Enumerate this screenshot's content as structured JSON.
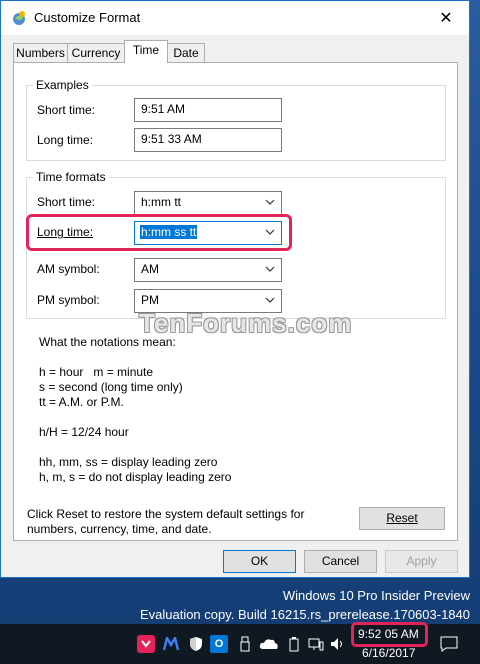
{
  "desktop": {
    "watermark_line1": "Windows 10 Pro Insider Preview",
    "watermark_line2": "Evaluation copy. Build 16215.rs_prerelease.170603-1840"
  },
  "dialog": {
    "title": "Customize Format",
    "close_glyph": "✕",
    "tabs": [
      {
        "label": "Numbers",
        "active": false
      },
      {
        "label": "Currency",
        "active": false
      },
      {
        "label": "Time",
        "active": true
      },
      {
        "label": "Date",
        "active": false
      }
    ],
    "examples": {
      "legend": "Examples",
      "short_label": "Short time:",
      "short_value": "9:51 AM",
      "long_label": "Long time:",
      "long_value": "9:51 33 AM"
    },
    "time_formats": {
      "legend": "Time formats",
      "short_label": "Short time:",
      "short_value": "h:mm tt",
      "long_label": "Long time:",
      "long_value": "h:mm ss tt",
      "am_label": "AM symbol:",
      "am_value": "AM",
      "pm_label": "PM symbol:",
      "pm_value": "PM"
    },
    "site_watermark": "TenForums.com",
    "notations": {
      "heading": "What the notations mean:",
      "line1": "h = hour   m = minute",
      "line2": "s = second (long time only)",
      "line3": "tt = A.M. or P.M.",
      "line4": "h/H = 12/24 hour",
      "line5": "hh, mm, ss = display leading zero",
      "line6": "h, m, s = do not display leading zero"
    },
    "reset_text": "Click Reset to restore the system default settings for numbers, currency, time, and date.",
    "reset_label": "Reset",
    "ok_label": "OK",
    "cancel_label": "Cancel",
    "apply_label": "Apply"
  },
  "taskbar": {
    "clock_time": "9:52 05 AM",
    "clock_date": "6/16/2017"
  },
  "colors": {
    "accent": "#0078d7",
    "highlight": "#e3245b",
    "taskbar": "#101821"
  }
}
